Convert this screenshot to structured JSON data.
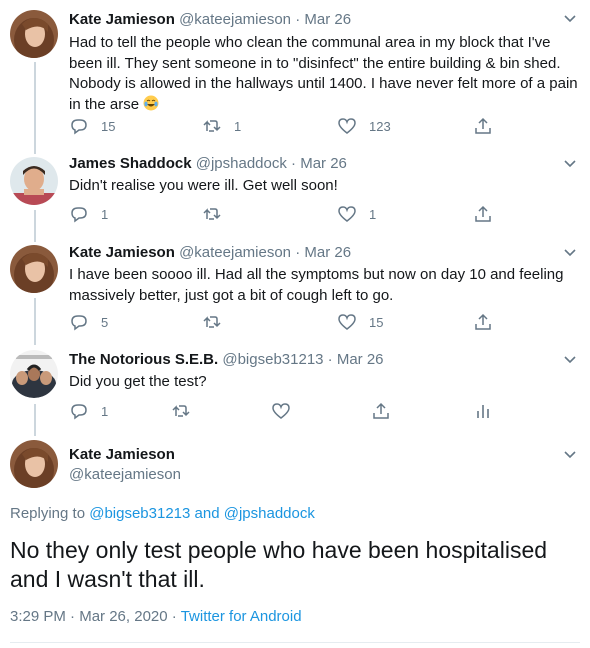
{
  "colors": {
    "link": "#1b95e0",
    "muted": "#657786",
    "text": "#14171a",
    "line": "#ccd6dd"
  },
  "tweets": [
    {
      "name": "Kate Jamieson",
      "handle": "@kateejamieson",
      "dot": "·",
      "date": "Mar 26",
      "lines": [
        "Had to tell the people who clean the communal area in my block that I've",
        "been ill. They sent someone in to \"disinfect\" the entire building & bin shed.",
        "Nobody is allowed in the hallways until 1400. I have never felt more of a pain",
        "in the arse"
      ],
      "emoji": "face-with-tears-of-joy",
      "replies": "15",
      "retweets": "1",
      "likes": "123",
      "avatar": "avatar-kate"
    },
    {
      "name": "James Shaddock",
      "handle": "@jpshaddock",
      "dot": "·",
      "date": "Mar 26",
      "lines": [
        "Didn't realise you were ill. Get well soon!"
      ],
      "replies": "1",
      "retweets": "",
      "likes": "1",
      "avatar": "avatar-james"
    },
    {
      "name": "Kate Jamieson",
      "handle": "@kateejamieson",
      "dot": "·",
      "date": "Mar 26",
      "lines": [
        "I have been soooo ill. Had all the symptoms but now on day 10 and feeling",
        "massively better, just got a bit of cough left to go."
      ],
      "replies": "5",
      "retweets": "",
      "likes": "15",
      "avatar": "avatar-kate"
    },
    {
      "name": "The Notorious S.E.B.",
      "handle": "@bigseb31213",
      "dot": "·",
      "date": "Mar 26",
      "lines": [
        "Did you get the test?"
      ],
      "replies": "1",
      "retweets": "",
      "likes": "",
      "avatar": "avatar-seb"
    }
  ],
  "main": {
    "name": "Kate Jamieson",
    "handle": "@kateejamieson",
    "replying_prefix": "Replying to",
    "replying_to_1": "@bigseb31213",
    "replying_and": "and",
    "replying_to_2": "@jpshaddock",
    "text_line_1": "No they only test people who have been hospitalised",
    "text_line_2": "and I wasn't that ill.",
    "time": "3:29 PM",
    "date": "Mar 26, 2020",
    "separator": "·",
    "source": "Twitter for Android"
  }
}
